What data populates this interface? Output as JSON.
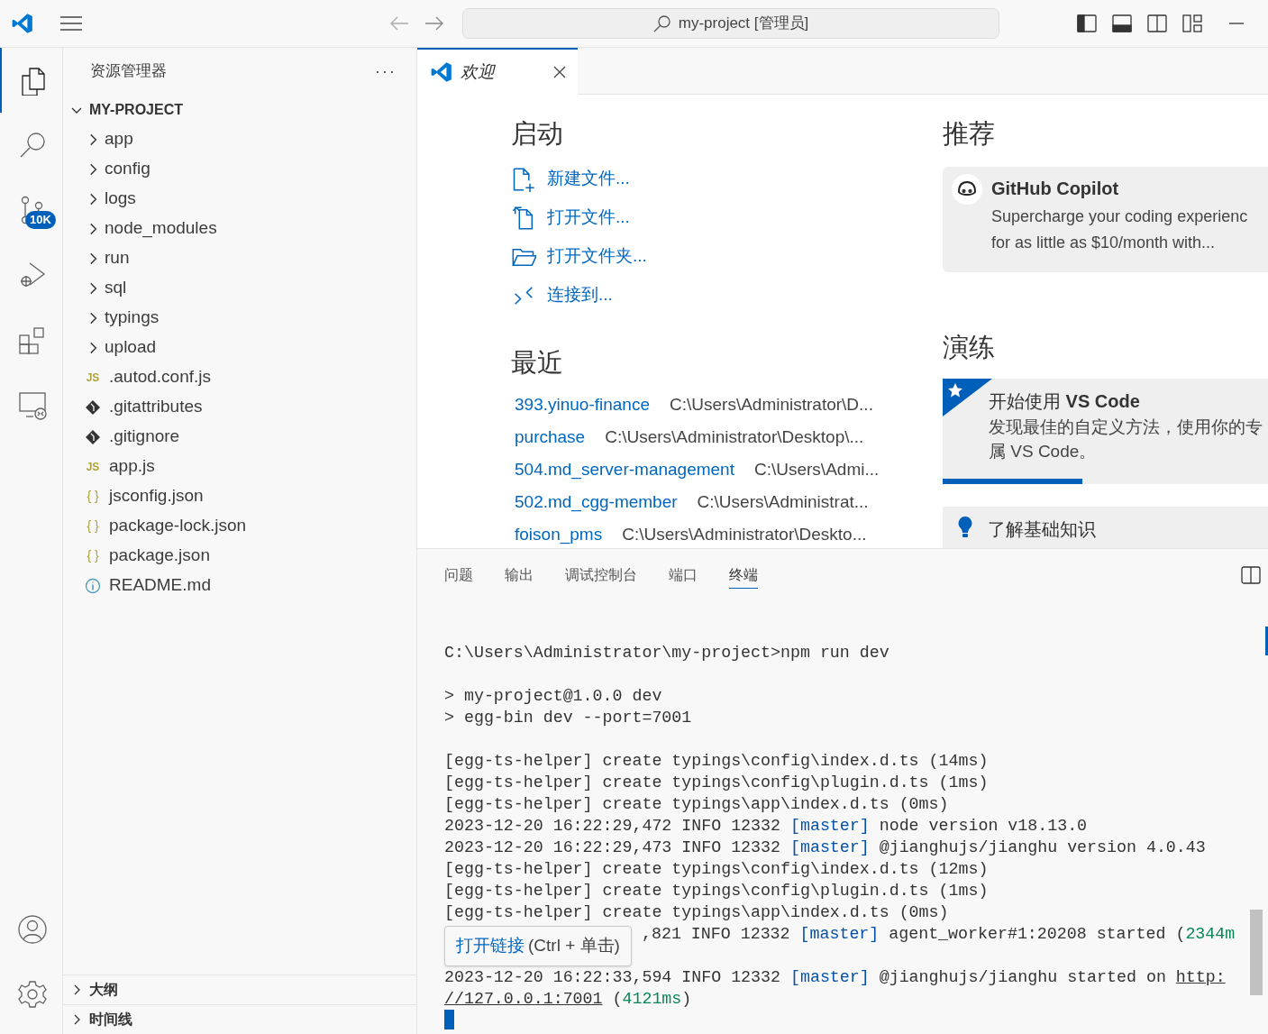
{
  "title_bar": {
    "command_center": "my-project [管理员]"
  },
  "activity_bar": {
    "top": [
      {
        "kind": "explorer",
        "selected": true
      },
      {
        "kind": "search",
        "selected": false
      },
      {
        "kind": "scm",
        "selected": false,
        "badge": "10K"
      },
      {
        "kind": "debug",
        "selected": false
      },
      {
        "kind": "extensions",
        "selected": false
      },
      {
        "kind": "remote",
        "selected": false
      }
    ],
    "bottom": [
      {
        "kind": "account",
        "selected": false
      },
      {
        "kind": "settings",
        "selected": false
      }
    ]
  },
  "sidebar": {
    "title": "资源管理器",
    "more": "···",
    "tree": {
      "label": "MY-PROJECT",
      "expanded": true,
      "children": [
        {
          "label": "app",
          "kind": "folder",
          "expanded": false
        },
        {
          "label": "config",
          "kind": "folder",
          "expanded": false
        },
        {
          "label": "logs",
          "kind": "folder",
          "expanded": false
        },
        {
          "label": "node_modules",
          "kind": "folder",
          "expanded": false
        },
        {
          "label": "run",
          "kind": "folder",
          "expanded": false
        },
        {
          "label": "sql",
          "kind": "folder",
          "expanded": false
        },
        {
          "label": "typings",
          "kind": "folder",
          "expanded": false
        },
        {
          "label": "upload",
          "kind": "folder",
          "expanded": false
        },
        {
          "label": ".autod.conf.js",
          "kind": "js",
          "icon_text": "JS"
        },
        {
          "label": ".gitattributes",
          "kind": "git"
        },
        {
          "label": ".gitignore",
          "kind": "git"
        },
        {
          "label": "app.js",
          "kind": "js",
          "icon_text": "JS"
        },
        {
          "label": "jsconfig.json",
          "kind": "json",
          "icon_text": "{ }"
        },
        {
          "label": "package-lock.json",
          "kind": "json",
          "icon_text": "{ }"
        },
        {
          "label": "package.json",
          "kind": "json",
          "icon_text": "{ }"
        },
        {
          "label": "README.md",
          "kind": "info"
        }
      ]
    },
    "sections": [
      {
        "label": "大纲",
        "expanded": false
      },
      {
        "label": "时间线",
        "expanded": false
      }
    ]
  },
  "editor": {
    "tabs": [
      {
        "label": "欢迎",
        "selected": true
      }
    ],
    "welcome": {
      "start": {
        "heading": "启动",
        "actions": [
          {
            "kind": "new_file",
            "label": "新建文件..."
          },
          {
            "kind": "open_file",
            "label": "打开文件..."
          },
          {
            "kind": "open_folder",
            "label": "打开文件夹..."
          },
          {
            "kind": "connect",
            "label": "连接到..."
          }
        ]
      },
      "recent": {
        "heading": "最近",
        "items": [
          {
            "name": "393.yinuo-finance",
            "path": "C:\\Users\\Administrator\\D..."
          },
          {
            "name": "purchase",
            "path": "C:\\Users\\Administrator\\Desktop\\..."
          },
          {
            "name": "504.md_server-management",
            "path": "C:\\Users\\Admi..."
          },
          {
            "name": "502.md_cgg-member",
            "path": "C:\\Users\\Administrat..."
          },
          {
            "name": "foison_pms",
            "path": "C:\\Users\\Administrator\\Deskto..."
          }
        ]
      },
      "recommended": {
        "heading": "推荐",
        "card": {
          "title": "GitHub Copilot",
          "lines": [
            "Supercharge your coding experienc",
            "for as little as $10/month with..."
          ]
        }
      },
      "walkthroughs": {
        "heading": "演练",
        "items": [
          {
            "kind": "featured",
            "title": "开始使用 **VS Code**",
            "description": "发现最佳的自定义方法，使用你的专属 VS Code。",
            "level": 0.43
          },
          {
            "kind": "basic",
            "title": "了解基础知识"
          }
        ]
      }
    }
  },
  "panel": {
    "tabs": [
      {
        "label": "问题",
        "selected": false
      },
      {
        "label": "输出",
        "selected": false
      },
      {
        "label": "调试控制台",
        "selected": false
      },
      {
        "label": "端口",
        "selected": false
      },
      {
        "label": "终端",
        "selected": true
      }
    ],
    "terminal": {
      "blocks": [
        [
          {
            "kind": "full",
            "segments": [
              {
                "text": "C:\\Users\\Administrator\\my-project>npm run dev",
                "kind": "plain"
              }
            ]
          }
        ],
        [
          {
            "kind": "full",
            "segments": [
              {
                "text": "> my-project@1.0.0 dev",
                "kind": "plain"
              }
            ]
          },
          {
            "kind": "full",
            "segments": [
              {
                "text": "> egg-bin dev --port=7001",
                "kind": "plain"
              }
            ]
          }
        ],
        [
          {
            "kind": "full",
            "segments": [
              {
                "text": "[egg-ts-helper] create typings\\config\\index.d.ts (14ms)",
                "kind": "plain"
              }
            ]
          },
          {
            "kind": "full",
            "segments": [
              {
                "text": "[egg-ts-helper] create typings\\config\\plugin.d.ts (1ms)",
                "kind": "plain"
              }
            ]
          },
          {
            "kind": "full",
            "segments": [
              {
                "text": "[egg-ts-helper] create typings\\app\\index.d.ts (0ms)",
                "kind": "plain"
              }
            ]
          },
          {
            "kind": "full",
            "segments": [
              {
                "text": "2023-12-20 16:22:29,472 INFO 12332 ",
                "kind": "plain"
              },
              {
                "text": "[master]",
                "kind": "tag"
              },
              {
                "text": " node version v18.13.0",
                "kind": "plain"
              }
            ]
          },
          {
            "kind": "full",
            "segments": [
              {
                "text": "2023-12-20 16:22:29,473 INFO 12332 ",
                "kind": "plain"
              },
              {
                "text": "[master]",
                "kind": "tag"
              },
              {
                "text": " @jianghujs/jianghu version 4.0.43",
                "kind": "plain"
              }
            ]
          },
          {
            "kind": "full",
            "segments": [
              {
                "text": "[egg-ts-helper] create typings\\config\\index.d.ts (12ms)",
                "kind": "plain"
              }
            ]
          },
          {
            "kind": "full",
            "segments": [
              {
                "text": "[egg-ts-helper] create typings\\config\\plugin.d.ts (1ms)",
                "kind": "plain"
              }
            ]
          },
          {
            "kind": "full",
            "segments": [
              {
                "text": "[egg-ts-helper] create typings\\app\\index.d.ts (0ms)",
                "kind": "plain"
              }
            ]
          },
          {
            "kind": "under_tooltip",
            "segments": [
              {
                "text": ",821 INFO 12332 ",
                "kind": "plain"
              },
              {
                "text": "[master]",
                "kind": "tag"
              },
              {
                "text": " agent_worker#1:20208 started (",
                "kind": "plain"
              },
              {
                "text": "2344m",
                "kind": "num"
              }
            ]
          }
        ],
        [
          {
            "kind": "full",
            "segments": [
              {
                "text": "2023-12-20 16:22:33,594 INFO 12332 ",
                "kind": "plain"
              },
              {
                "text": "[master]",
                "kind": "tag"
              },
              {
                "text": " @jianghujs/jianghu started on ",
                "kind": "plain"
              },
              {
                "text": "http:",
                "kind": "link"
              }
            ]
          },
          {
            "kind": "full",
            "segments": [
              {
                "text": "//127.0.0.1:7001",
                "kind": "link"
              },
              {
                "text": " (",
                "kind": "plain"
              },
              {
                "text": "4121ms",
                "kind": "num"
              },
              {
                "text": ")",
                "kind": "plain"
              }
            ]
          }
        ]
      ],
      "tooltip": {
        "link": "打开链接",
        "hint": "(Ctrl + 单击)"
      }
    }
  }
}
